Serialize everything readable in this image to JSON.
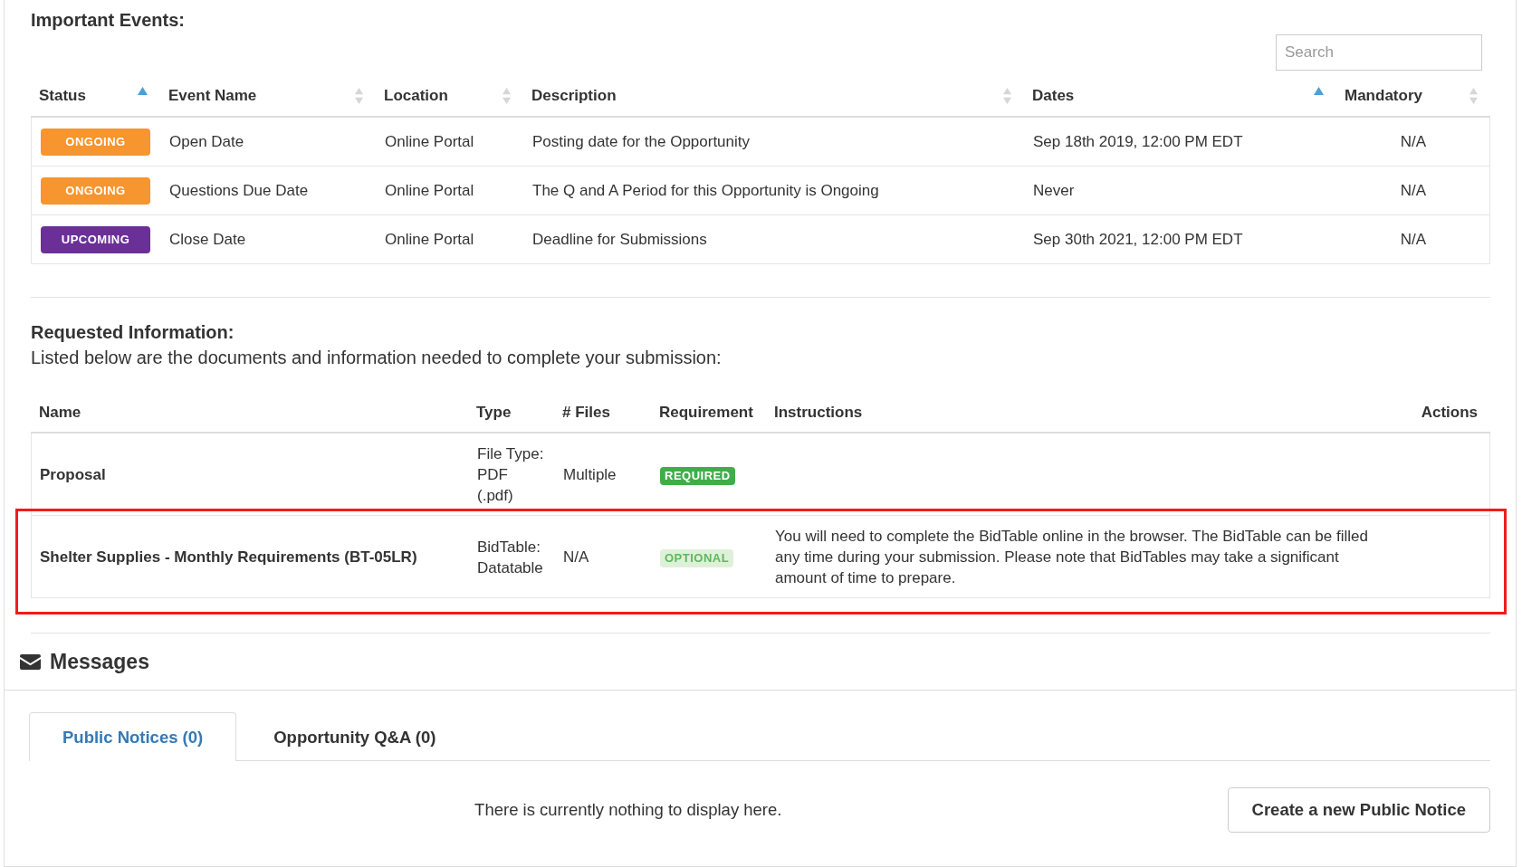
{
  "important_events": {
    "title": "Important Events:",
    "search": {
      "placeholder": "Search"
    },
    "columns": [
      {
        "label": "Status",
        "sorted": true
      },
      {
        "label": "Event Name",
        "sorted": false
      },
      {
        "label": "Location",
        "sorted": false
      },
      {
        "label": "Description",
        "sorted": false
      },
      {
        "label": "Dates",
        "sorted": true
      },
      {
        "label": "Mandatory",
        "sorted": false
      }
    ],
    "rows": [
      {
        "status": {
          "label": "ONGOING",
          "color": "#f7952f"
        },
        "event_name": "Open Date",
        "location": "Online Portal",
        "description": "Posting date for the Opportunity",
        "dates": "Sep 18th 2019, 12:00 PM EDT",
        "mandatory": "N/A"
      },
      {
        "status": {
          "label": "ONGOING",
          "color": "#f7952f"
        },
        "event_name": "Questions Due Date",
        "location": "Online Portal",
        "description": "The Q and A Period for this Opportunity is Ongoing",
        "dates": "Never",
        "mandatory": "N/A"
      },
      {
        "status": {
          "label": "UPCOMING",
          "color": "#6a3097"
        },
        "event_name": "Close Date",
        "location": "Online Portal",
        "description": "Deadline for Submissions",
        "dates": "Sep 30th 2021, 12:00 PM EDT",
        "mandatory": "N/A"
      }
    ]
  },
  "requested_information": {
    "title": "Requested Information:",
    "subtitle": "Listed below are the documents and information needed to complete your submission:",
    "columns": [
      "Name",
      "Type",
      "# Files",
      "Requirement",
      "Instructions",
      "Actions"
    ],
    "rows": [
      {
        "name": "Proposal",
        "type": "File Type: PDF (.pdf)",
        "files": "Multiple",
        "requirement": {
          "label": "REQUIRED",
          "kind": "required"
        },
        "highlighted": false
      },
      {
        "name": "Shelter Supplies - Monthly Requirements (BT-05LR)",
        "type": "BidTable: Datatable",
        "files": "N/A",
        "requirement": {
          "label": "OPTIONAL",
          "kind": "optional"
        },
        "instructions": "You will need to complete the BidTable online in the browser. The BidTable can be filled any time during your submission. Please note that BidTables may take a significant amount of time to prepare.",
        "highlighted": true
      }
    ]
  },
  "messages": {
    "title": "Messages",
    "tabs": [
      {
        "label": "Public Notices (0)",
        "selected": true
      },
      {
        "label": "Opportunity Q&A (0)",
        "selected": false
      }
    ],
    "empty_text": "There is currently nothing to display here.",
    "create_button": "Create a new Public Notice"
  }
}
